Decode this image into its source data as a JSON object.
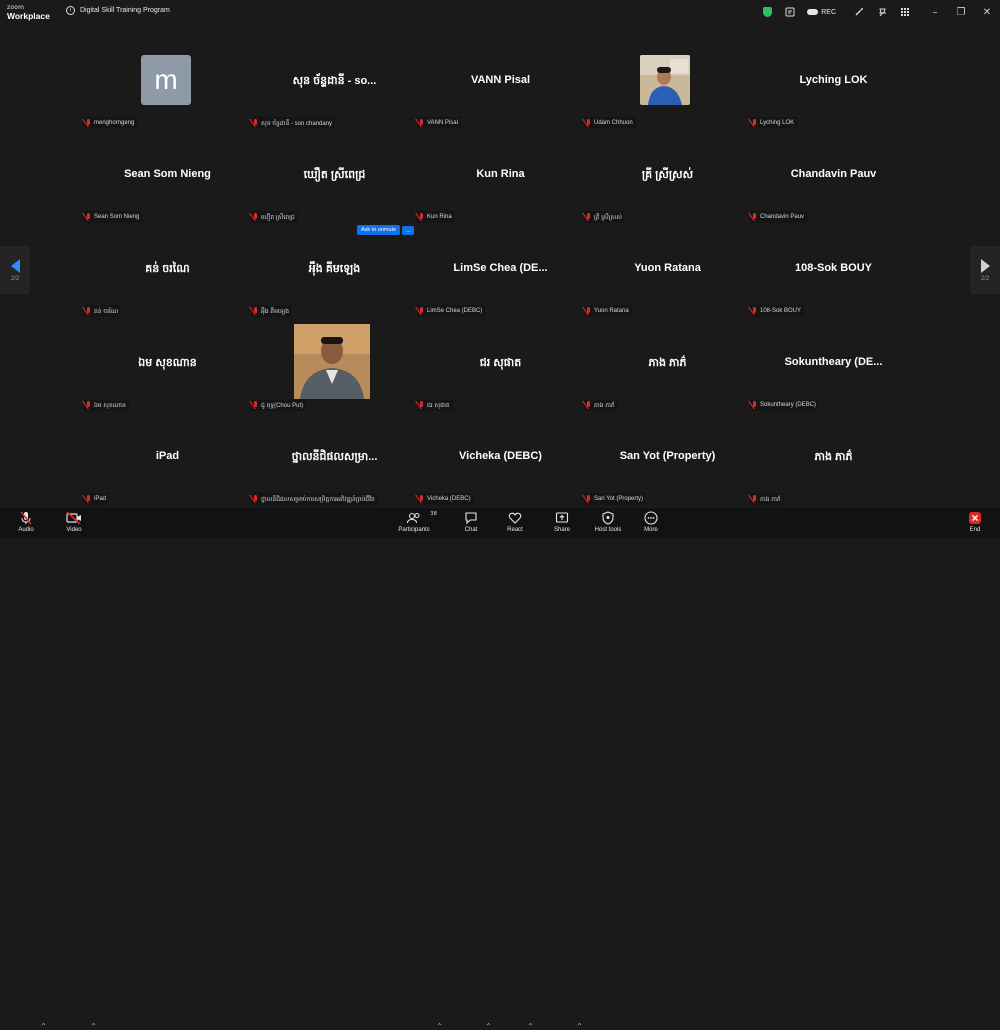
{
  "app": {
    "brand_line1": "zoom",
    "brand_line2": "Workplace"
  },
  "meeting": {
    "title": "Digital Skill Training Program"
  },
  "titlebar": {
    "rec_label": "REC"
  },
  "nav": {
    "left_page": "2/2",
    "right_page": "2/2"
  },
  "unmute_popup": {
    "label": "Ask to unmute",
    "more": "..."
  },
  "tiles": [
    {
      "name": "",
      "label": "menghorngeng"
    },
    {
      "name": "សុន ច័ន្ទដានី - so...",
      "label": "សុន ច័ន្ទដានី - son chandany"
    },
    {
      "name": "VANN Pisal",
      "label": "VANN Pisal"
    },
    {
      "name": "",
      "label": "Udam Chhuon"
    },
    {
      "name": "Lyching LOK",
      "label": "Lyching LOK"
    },
    {
      "name": "Sean Som Nieng",
      "label": "Sean Som Nieng"
    },
    {
      "name": "ឃឿត ស្រីពេជ្រ",
      "label": "ឃឿត ស្រីពេជ្រ"
    },
    {
      "name": "Kun Rina",
      "label": "Kun Rina"
    },
    {
      "name": "គ្រី ស្រីស្រស់",
      "label": "គ្រី ស្រីស្រស់"
    },
    {
      "name": "Chandavin Pauv",
      "label": "Chandavin Pauv"
    },
    {
      "name": "គន់ ចរណៃ",
      "label": "គន់ ចរណៃ"
    },
    {
      "name": "អុឹង គីមឡេង",
      "label": "អុឹង គីមឡេង"
    },
    {
      "name": "LimSe Chea (DE...",
      "label": "LimSe Chea (DEBC)"
    },
    {
      "name": "Yuon Ratana",
      "label": "Yuon Ratana"
    },
    {
      "name": "108-Sok BOUY",
      "label": "108-Sok BOUY"
    },
    {
      "name": "ឯម សុខណាន",
      "label": "ឯម សុខណាន"
    },
    {
      "name": "",
      "label": "ជូ ពុទ្ធ(Chou Put)"
    },
    {
      "name": "ជរ សុផាត",
      "label": "ជរ សុផាត"
    },
    {
      "name": "ភាង ភាភ៌",
      "label": "ភាង ភាភ៌"
    },
    {
      "name": "Sokuntheary (DE...",
      "label": "Sokuntheary (DEBC)"
    },
    {
      "name": "iPad",
      "label": "iPad"
    },
    {
      "name": "ថ្នាលនីជិផលសម្រា...",
      "label": "ថ្នាលនីជិផលសម្រាប់ការសម្រិត្តការអភិវឌ្ឍន៍ព្រប់ជីវិត"
    },
    {
      "name": "Vicheka (DEBC)",
      "label": "Vicheka (DEBC)"
    },
    {
      "name": "San Yot (Property)",
      "label": "San Yot (Property)"
    },
    {
      "name": "ភាង ភាភ៌",
      "label": "ភាង ភាភ៌"
    }
  ],
  "avatar_letter": "m",
  "toolbar": {
    "audio": "Audio",
    "video": "Video",
    "participants": "Participants",
    "participants_count": "38",
    "chat": "Chat",
    "react": "React",
    "share": "Share",
    "host_tools": "Host tools",
    "more": "More",
    "end": "End"
  },
  "colors": {
    "background": "#1a1a1a",
    "accent_blue": "#2d8cff",
    "muted_red": "#e02828",
    "secure_green": "#22c55e",
    "end_red": "#e02828"
  }
}
